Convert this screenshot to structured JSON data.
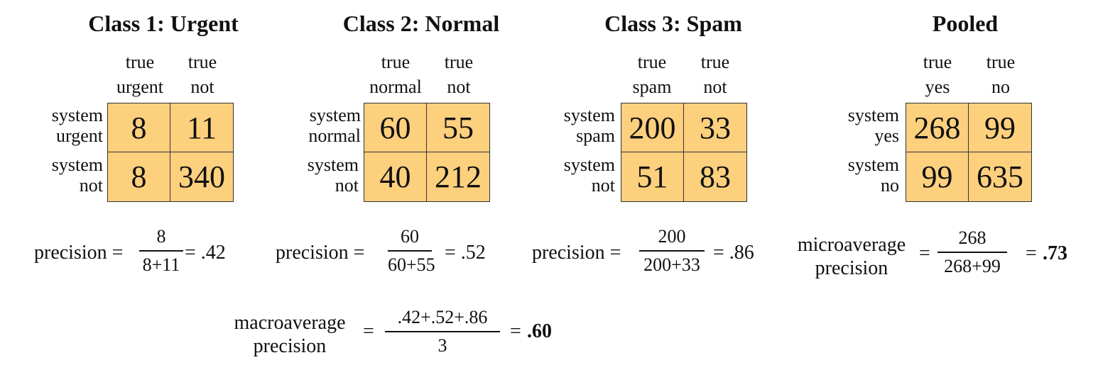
{
  "tables": [
    {
      "title": "Class 1: Urgent",
      "col_headers": [
        [
          "true",
          "urgent"
        ],
        [
          "true",
          "not"
        ]
      ],
      "row_headers": [
        [
          "system",
          "urgent"
        ],
        [
          "system",
          "not"
        ]
      ],
      "cells": [
        [
          "8",
          "11"
        ],
        [
          "8",
          "340"
        ]
      ]
    },
    {
      "title": "Class 2: Normal",
      "col_headers": [
        [
          "true",
          "normal"
        ],
        [
          "true",
          "not"
        ]
      ],
      "row_headers": [
        [
          "system",
          "normal"
        ],
        [
          "system",
          "not"
        ]
      ],
      "cells": [
        [
          "60",
          "55"
        ],
        [
          "40",
          "212"
        ]
      ]
    },
    {
      "title": "Class 3: Spam",
      "col_headers": [
        [
          "true",
          "spam"
        ],
        [
          "true",
          "not"
        ]
      ],
      "row_headers": [
        [
          "system",
          "spam"
        ],
        [
          "system",
          "not"
        ]
      ],
      "cells": [
        [
          "200",
          "33"
        ],
        [
          "51",
          "83"
        ]
      ]
    },
    {
      "title": "Pooled",
      "col_headers": [
        [
          "true",
          "yes"
        ],
        [
          "true",
          "no"
        ]
      ],
      "row_headers": [
        [
          "system",
          "yes"
        ],
        [
          "system",
          "no"
        ]
      ],
      "cells": [
        [
          "268",
          "99"
        ],
        [
          "99",
          "635"
        ]
      ]
    }
  ],
  "precisions": [
    {
      "label": "precision =",
      "numerator": "8",
      "denominator": "8+11",
      "result": "= .42"
    },
    {
      "label": "precision =",
      "numerator": "60",
      "denominator": "60+55",
      "result": "= .52"
    },
    {
      "label": "precision =",
      "numerator": "200",
      "denominator": "200+33",
      "result": "= .86"
    }
  ],
  "micro": {
    "label_line1": "microaverage",
    "label_line2": "precision",
    "eq": "=",
    "numerator": "268",
    "denominator": "268+99",
    "result_prefix": "=",
    "result": ".73"
  },
  "macro": {
    "label_line1": "macroaverage",
    "label_line2": "precision",
    "eq": "=",
    "numerator": ".42+.52+.86",
    "denominator": "3",
    "result_prefix": "=",
    "result": ".60"
  },
  "colors": {
    "cell_fill": "#fdd07e",
    "border": "#333333",
    "text": "#111111"
  }
}
